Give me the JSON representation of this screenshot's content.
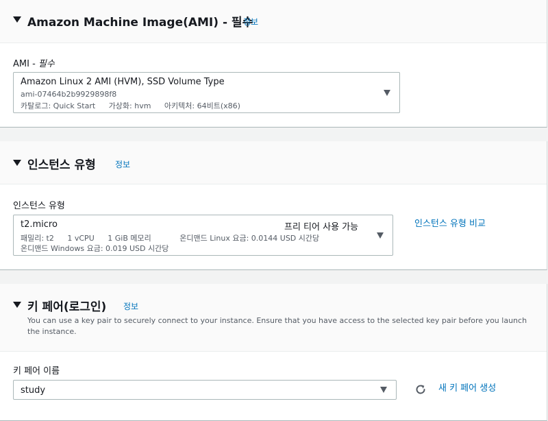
{
  "ami_section": {
    "title": "Amazon Machine Image(AMI) - 필수",
    "info": "정보",
    "field_label": "AMI - ",
    "field_required": "필수",
    "selected_name": "Amazon Linux 2 AMI (HVM), SSD Volume Type",
    "selected_id": "ami-07464b2b9929898f8",
    "catalog": "카탈로그: Quick Start",
    "virtualization": "가상화: hvm",
    "architecture": "아키텍처: 64비트(x86)"
  },
  "instance_section": {
    "title": "인스턴스 유형",
    "info": "정보",
    "field_label": "인스턴스 유형",
    "selected_type": "t2.micro",
    "free_tier": "프리 티어 사용 가능",
    "family": "패밀리: t2",
    "vcpu": "1 vCPU",
    "memory": "1 GiB 메모리",
    "linux_price": "온디맨드 Linux 요금: 0.0144 USD 시간당",
    "windows_price": "온디맨드 Windows 요금: 0.019 USD 시간당",
    "compare_link": "인스턴스 유형 비교"
  },
  "keypair_section": {
    "title": "키 페어(로그인)",
    "info": "정보",
    "description": "You can use a key pair to securely connect to your instance. Ensure that you have access to the selected key pair before you launch the instance.",
    "field_label": "키 페어 이름",
    "selected_key": "study",
    "create_link": "새 키 페어 생성"
  },
  "icons": [
    "caret-down-icon",
    "dropdown-arrow-icon",
    "refresh-icon"
  ],
  "colors": {
    "link": "#0073bb",
    "text": "#16191f",
    "secondary_text": "#545b64",
    "border": "#aab7b8"
  }
}
